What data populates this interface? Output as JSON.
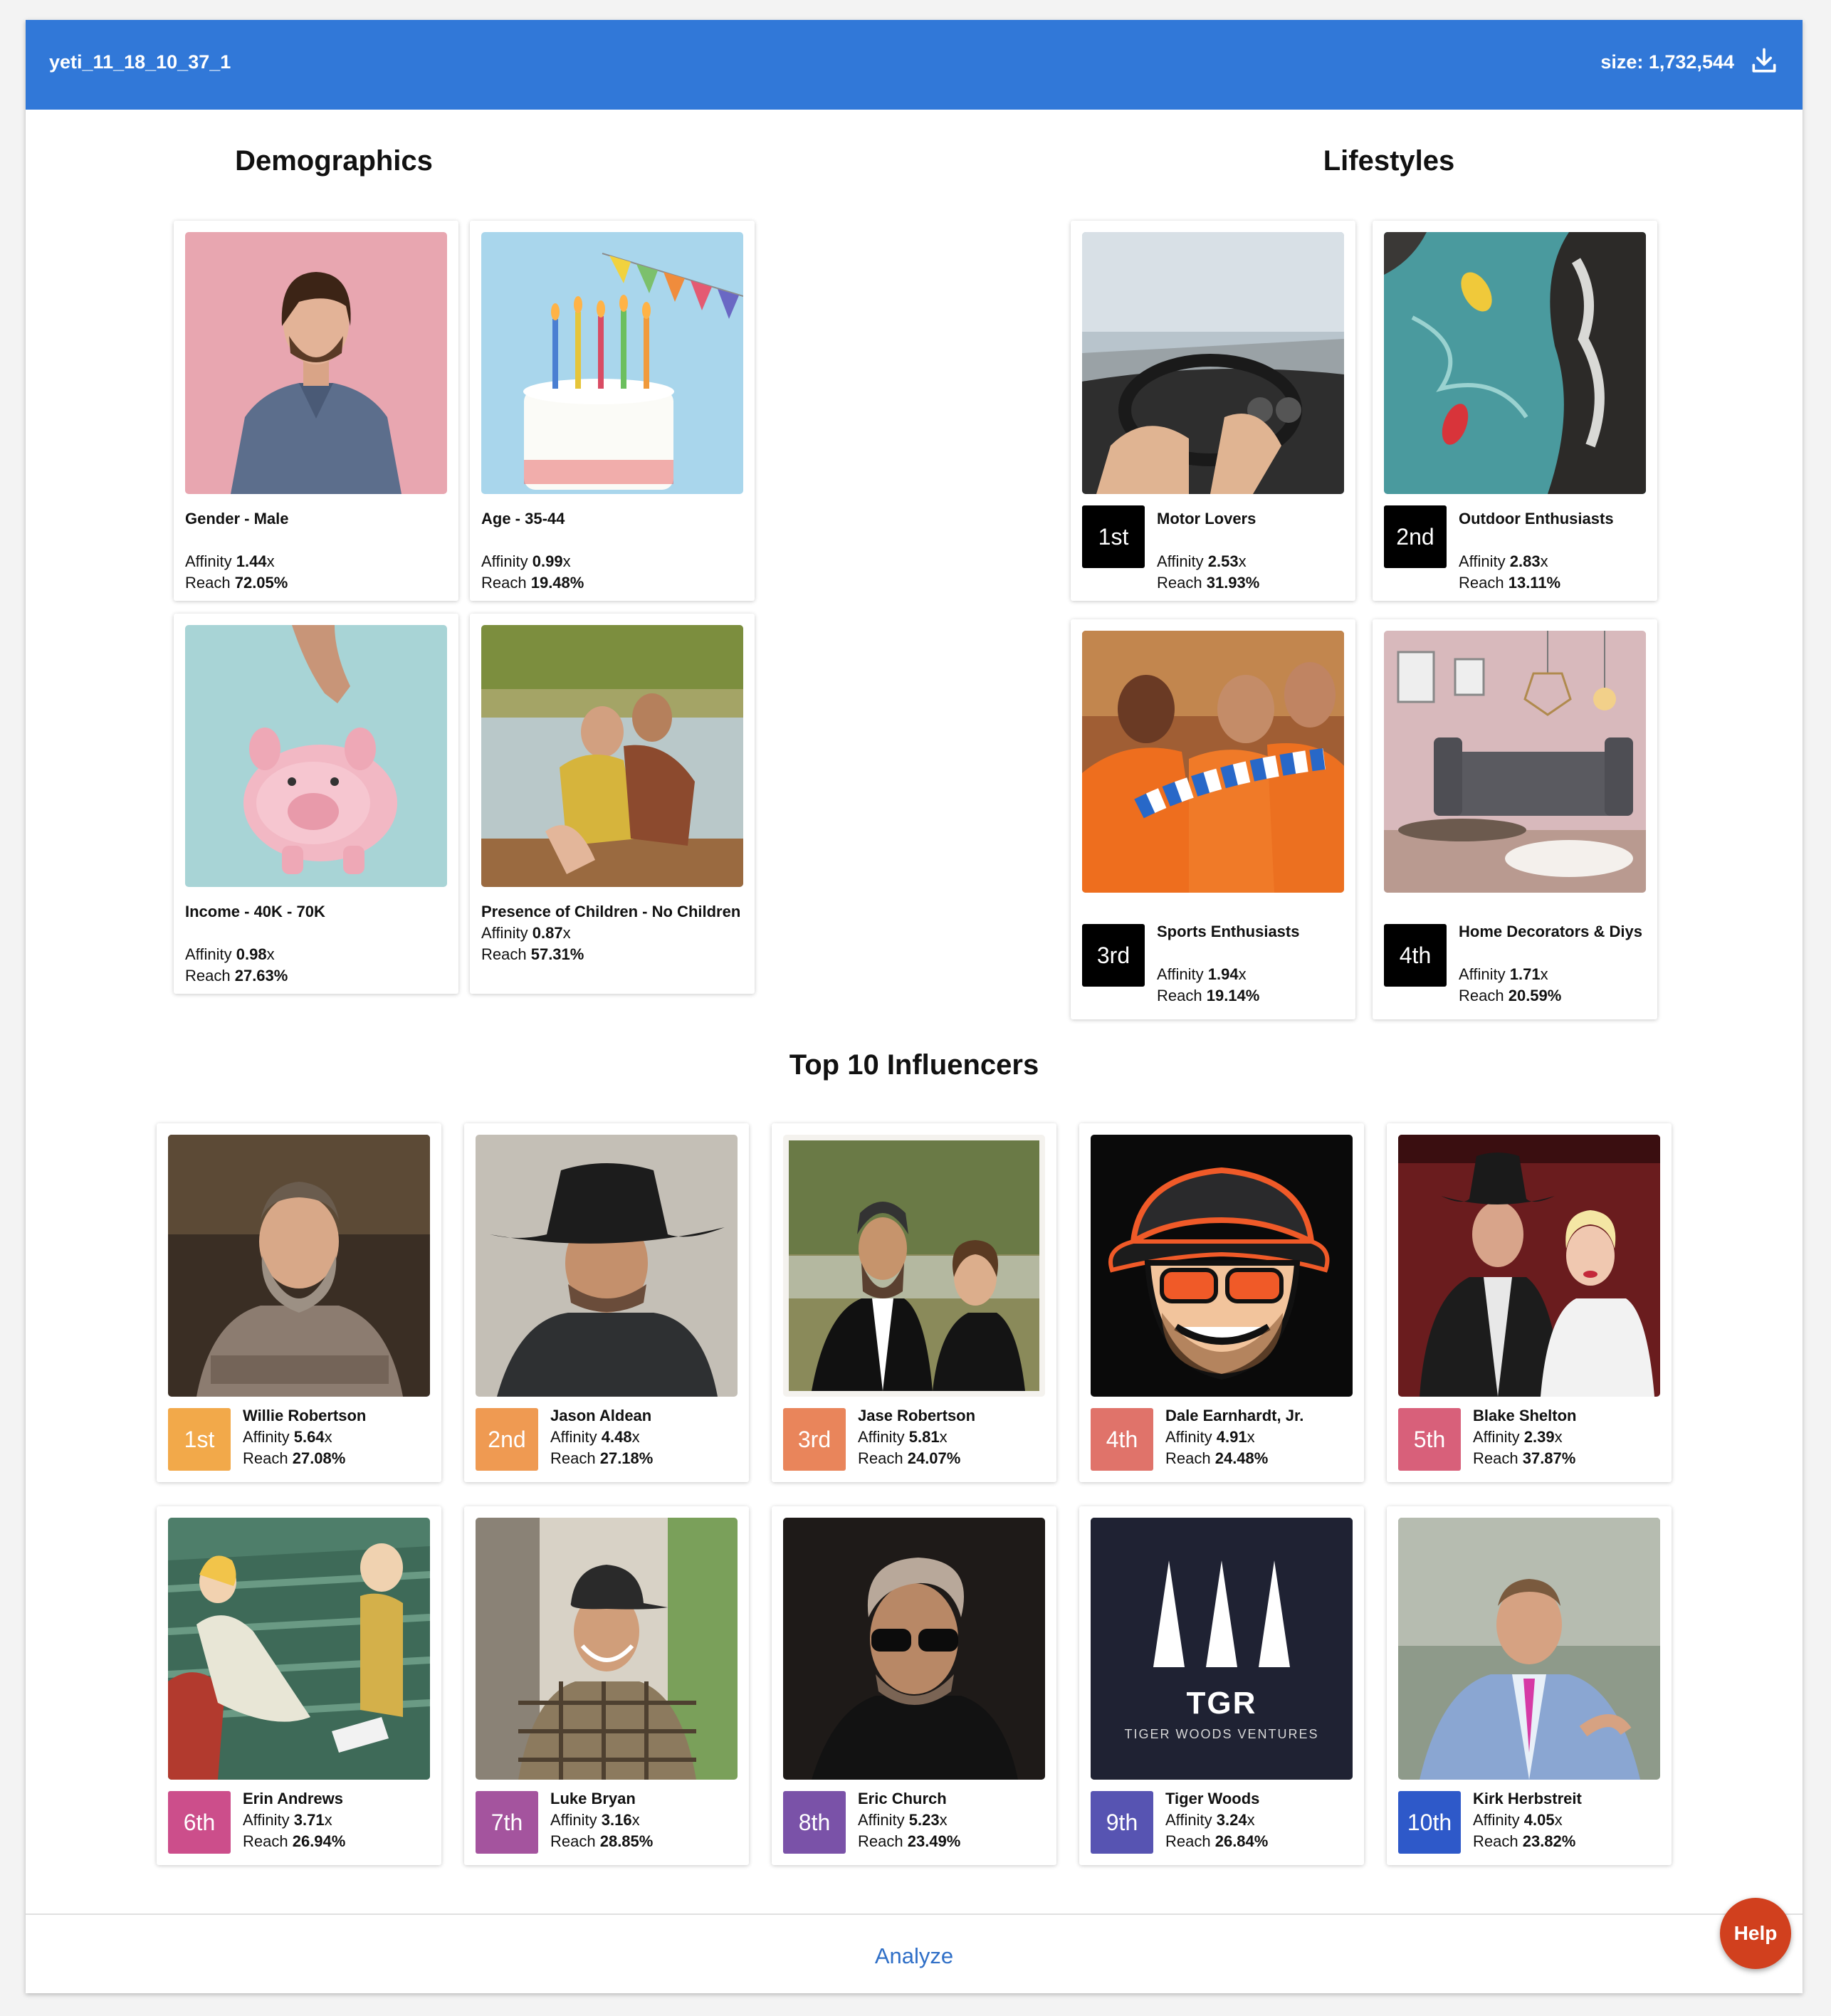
{
  "header": {
    "title": "yeti_11_18_10_37_1",
    "size_label": "size: 1,732,544",
    "download_icon": "download-icon"
  },
  "demographics": {
    "title": "Demographics",
    "cards": [
      {
        "label": "Gender - Male",
        "affinity_prefix": "Affinity ",
        "affinity": "1.44",
        "affinity_suffix": "x",
        "reach_prefix": "Reach ",
        "reach": "72.05%"
      },
      {
        "label": "Age - 35-44",
        "affinity_prefix": "Affinity ",
        "affinity": "0.99",
        "affinity_suffix": "x",
        "reach_prefix": "Reach ",
        "reach": "19.48%"
      },
      {
        "label": "Income - 40K - 70K",
        "affinity_prefix": "Affinity ",
        "affinity": "0.98",
        "affinity_suffix": "x",
        "reach_prefix": "Reach ",
        "reach": "27.63%"
      },
      {
        "label": "Presence of Children - No Children",
        "affinity_prefix": "Affinity ",
        "affinity": "0.87",
        "affinity_suffix": "x",
        "reach_prefix": "Reach ",
        "reach": "57.31%"
      }
    ]
  },
  "lifestyles": {
    "title": "Lifestyles",
    "cards": [
      {
        "rank": "1st",
        "label": "Motor Lovers",
        "affinity_prefix": "Affinity ",
        "affinity": "2.53",
        "affinity_suffix": "x",
        "reach_prefix": "Reach ",
        "reach": "31.93%"
      },
      {
        "rank": "2nd",
        "label": "Outdoor Enthusiasts",
        "affinity_prefix": "Affinity ",
        "affinity": "2.83",
        "affinity_suffix": "x",
        "reach_prefix": "Reach ",
        "reach": "13.11%"
      },
      {
        "rank": "3rd",
        "label": "Sports Enthusiasts",
        "affinity_prefix": "Affinity ",
        "affinity": "1.94",
        "affinity_suffix": "x",
        "reach_prefix": "Reach ",
        "reach": "19.14%"
      },
      {
        "rank": "4th",
        "label": "Home Decorators & Diys",
        "affinity_prefix": "Affinity ",
        "affinity": "1.71",
        "affinity_suffix": "x",
        "reach_prefix": "Reach ",
        "reach": "20.59%"
      }
    ]
  },
  "influencers": {
    "title": "Top 10 Influencers",
    "cards": [
      {
        "rank": "1st",
        "name": "Willie Robertson",
        "affinity_prefix": "Affinity ",
        "affinity": "5.64",
        "affinity_suffix": "x",
        "reach_prefix": "Reach ",
        "reach": "27.08%",
        "color": "#f2a94a"
      },
      {
        "rank": "2nd",
        "name": "Jason Aldean",
        "affinity_prefix": "Affinity ",
        "affinity": "4.48",
        "affinity_suffix": "x",
        "reach_prefix": "Reach ",
        "reach": "27.18%",
        "color": "#ef9a52"
      },
      {
        "rank": "3rd",
        "name": "Jase Robertson",
        "affinity_prefix": "Affinity ",
        "affinity": "5.81",
        "affinity_suffix": "x",
        "reach_prefix": "Reach ",
        "reach": "24.07%",
        "color": "#e9855b"
      },
      {
        "rank": "4th",
        "name": "Dale Earnhardt, Jr.",
        "affinity_prefix": "Affinity ",
        "affinity": "4.91",
        "affinity_suffix": "x",
        "reach_prefix": "Reach ",
        "reach": "24.48%",
        "color": "#e0736a"
      },
      {
        "rank": "5th",
        "name": "Blake Shelton",
        "affinity_prefix": "Affinity ",
        "affinity": "2.39",
        "affinity_suffix": "x",
        "reach_prefix": "Reach ",
        "reach": "37.87%",
        "color": "#d8607a"
      },
      {
        "rank": "6th",
        "name": "Erin Andrews",
        "affinity_prefix": "Affinity ",
        "affinity": "3.71",
        "affinity_suffix": "x",
        "reach_prefix": "Reach ",
        "reach": "26.94%",
        "color": "#cc4e8b"
      },
      {
        "rank": "7th",
        "name": "Luke Bryan",
        "affinity_prefix": "Affinity ",
        "affinity": "3.16",
        "affinity_suffix": "x",
        "reach_prefix": "Reach ",
        "reach": "28.85%",
        "color": "#a4549e"
      },
      {
        "rank": "8th",
        "name": "Eric Church",
        "affinity_prefix": "Affinity ",
        "affinity": "5.23",
        "affinity_suffix": "x",
        "reach_prefix": "Reach ",
        "reach": "23.49%",
        "color": "#7a52a8"
      },
      {
        "rank": "9th",
        "name": "Tiger Woods",
        "affinity_prefix": "Affinity ",
        "affinity": "3.24",
        "affinity_suffix": "x",
        "reach_prefix": "Reach ",
        "reach": "26.84%",
        "color": "#5754b2"
      },
      {
        "rank": "10th",
        "name": "Kirk Herbstreit",
        "affinity_prefix": "Affinity ",
        "affinity": "4.05",
        "affinity_suffix": "x",
        "reach_prefix": "Reach ",
        "reach": "23.82%",
        "color": "#2e59c9"
      }
    ],
    "tgr_logo_text": "TGR",
    "tgr_logo_subtext": "TIGER WOODS VENTURES"
  },
  "footer": {
    "analyze_label": "Analyze",
    "help_label": "Help"
  },
  "colors": {
    "header_bg": "#3178d8",
    "rank_black": "#000000",
    "help_bg": "#d1401e",
    "analyze_link": "#2f6fc7"
  }
}
